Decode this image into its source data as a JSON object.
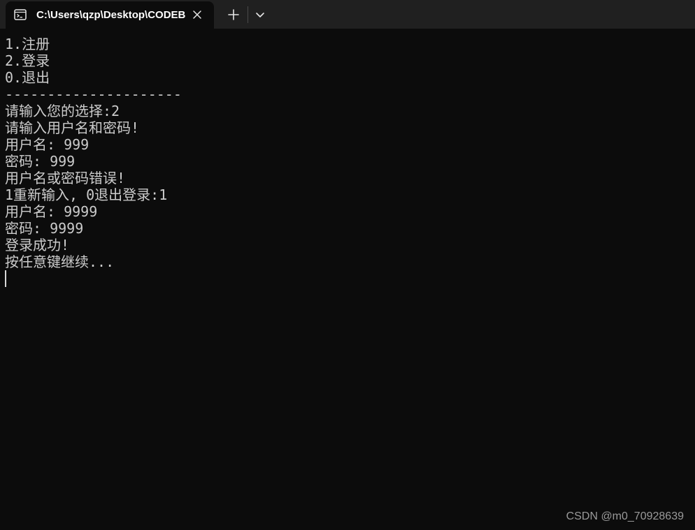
{
  "window": {
    "tab_title": "C:\\Users\\qzp\\Desktop\\CODEB",
    "icons": {
      "tab": "terminal-icon",
      "close": "close-icon",
      "new_tab": "plus-icon",
      "dropdown": "chevron-down-icon"
    }
  },
  "console": {
    "lines": [
      "1.注册",
      "2.登录",
      "0.退出",
      "---------------------",
      "请输入您的选择:2",
      "请输入用户名和密码!",
      "用户名: 999",
      "密码: 999",
      "用户名或密码错误!",
      "1重新输入, 0退出登录:1",
      "用户名: 9999",
      "密码: 9999",
      "登录成功!",
      "按任意键继续..."
    ]
  },
  "watermark": "CSDN @m0_70928639",
  "colors": {
    "background": "#0c0c0c",
    "titlebar": "#202020",
    "text": "#cccccc"
  }
}
